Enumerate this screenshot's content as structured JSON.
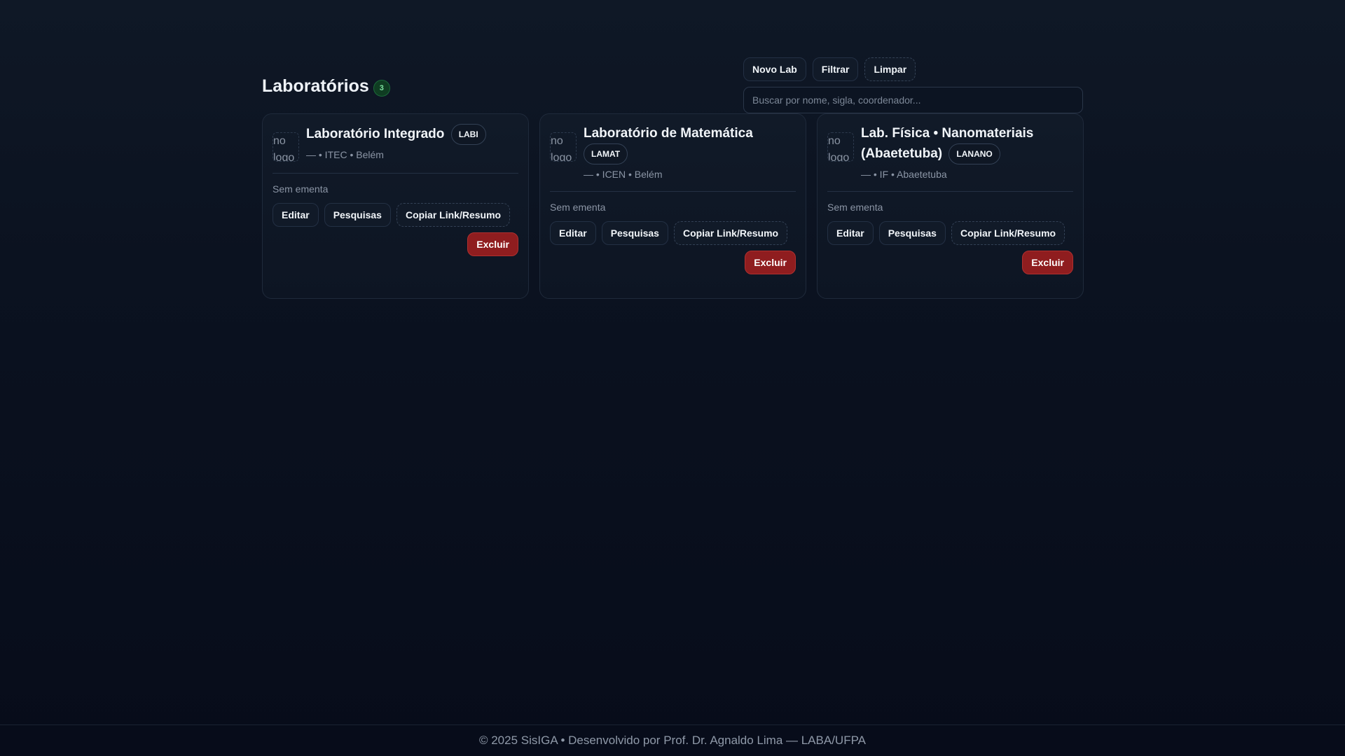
{
  "header": {
    "title": "Laboratórios",
    "count": "3",
    "actions": {
      "new_lab": "Novo Lab",
      "filter": "Filtrar",
      "clear": "Limpar"
    },
    "search_placeholder": "Buscar por nome, sigla, coordenador..."
  },
  "labs": [
    {
      "name": "Laboratório Integrado",
      "sigla": "LABI",
      "logo_text": "no logo",
      "meta": "— • ITEC • Belém",
      "ementa": "Sem ementa",
      "edit": "Editar",
      "research": "Pesquisas",
      "copy": "Copiar Link/Resumo",
      "delete": "Excluir"
    },
    {
      "name": "Laboratório de Matemática",
      "sigla": "LAMAT",
      "logo_text": "no logo",
      "meta": "— • ICEN • Belém",
      "ementa": "Sem ementa",
      "edit": "Editar",
      "research": "Pesquisas",
      "copy": "Copiar Link/Resumo",
      "delete": "Excluir"
    },
    {
      "name": "Lab. Física • Nanomateriais (Abaetetuba)",
      "sigla": "LANANO",
      "logo_text": "no logo",
      "meta": "— • IF • Abaetetuba",
      "ementa": "Sem ementa",
      "edit": "Editar",
      "research": "Pesquisas",
      "copy": "Copiar Link/Resumo",
      "delete": "Excluir"
    }
  ],
  "footer": {
    "text": "© 2025 SisIGA • Desenvolvido por Prof. Dr. Agnaldo Lima — LABA/UFPA"
  },
  "colors": {
    "danger": "#8f1d1f",
    "badge_green": "#7ee2a0",
    "background": "#0b1220"
  }
}
